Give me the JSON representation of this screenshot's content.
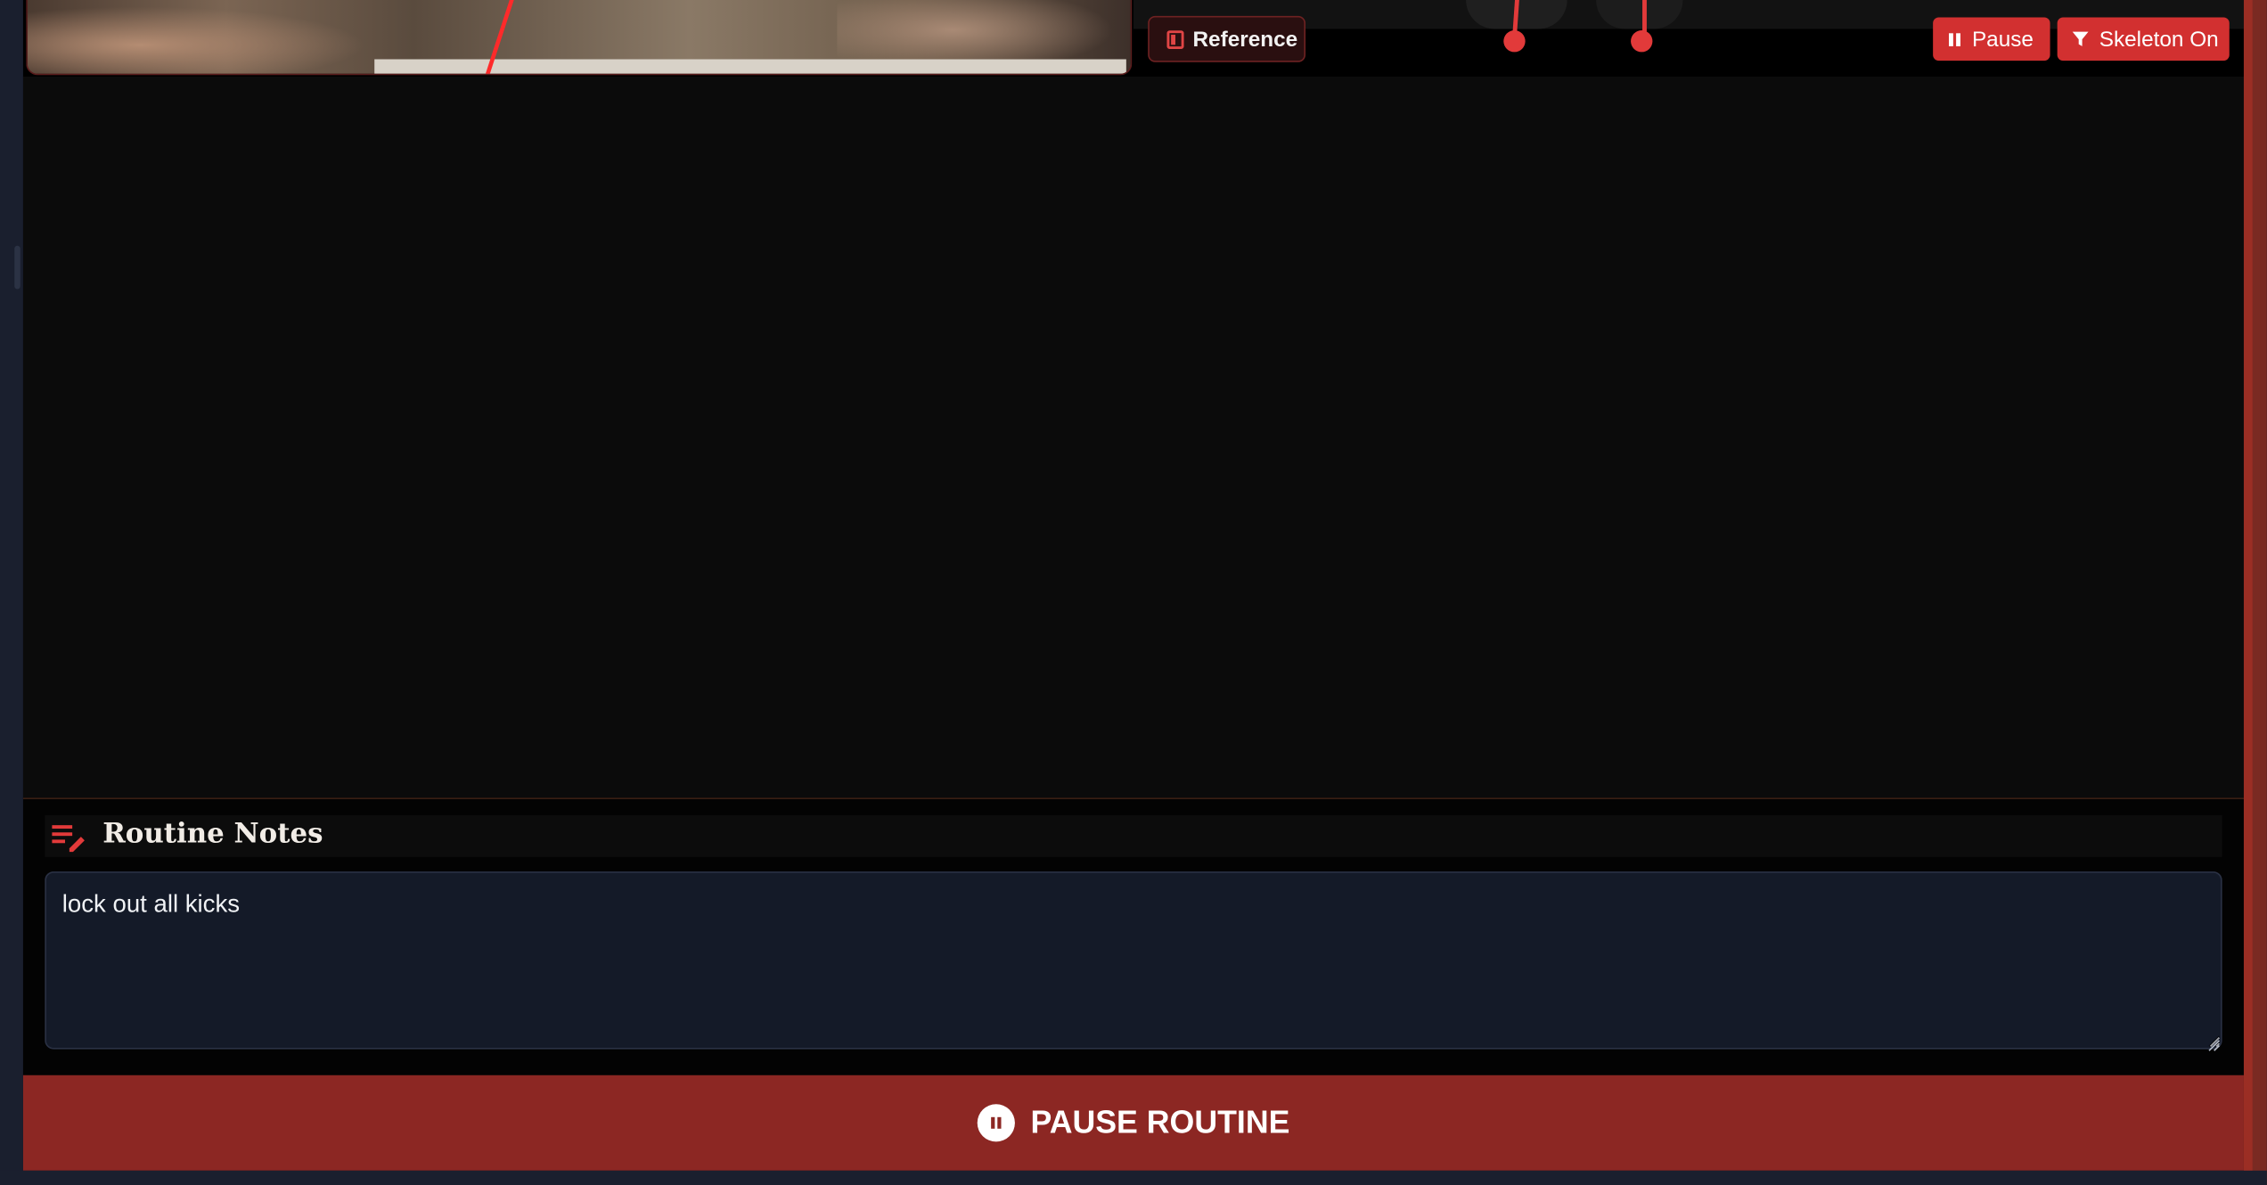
{
  "top_bar": {
    "reference_label": "Reference",
    "pause_label": "Pause",
    "skeleton_label": "Skeleton On"
  },
  "notes": {
    "title": "Routine Notes",
    "value": "lock out all kicks"
  },
  "cta": {
    "label": "PAUSE ROUTINE"
  },
  "icons": {
    "reference": "book-icon",
    "pause": "pause-icon",
    "skeleton": "filter-icon",
    "notes": "edit-notes-icon",
    "cta": "pause-circle-icon"
  },
  "colors": {
    "accent_red": "#d23030",
    "cta_red": "#8c2723",
    "background": "#0a0a0a",
    "input_bg": "#141a28"
  }
}
